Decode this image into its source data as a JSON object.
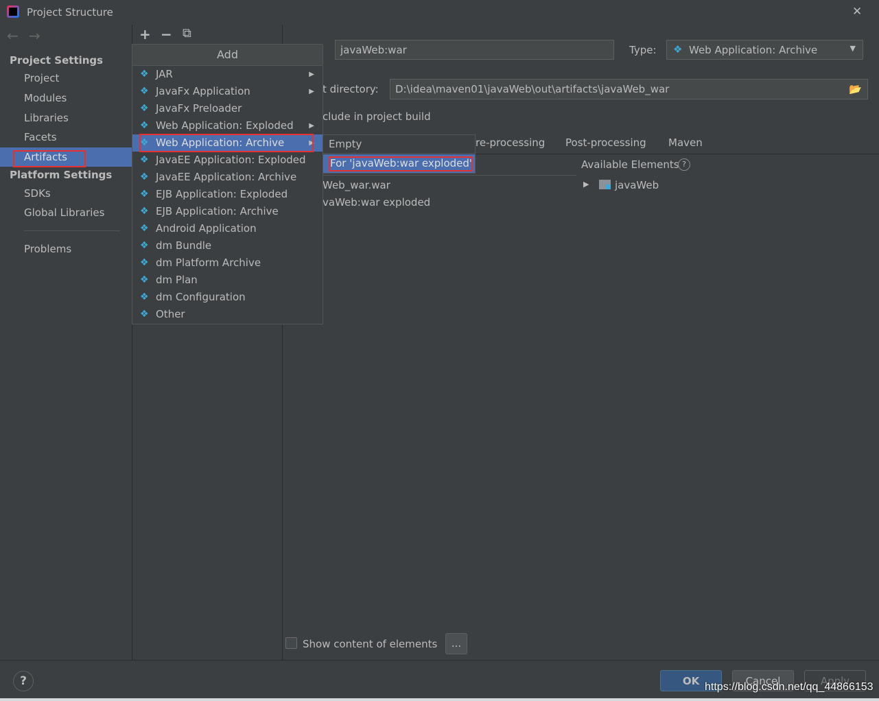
{
  "window": {
    "title": "Project Structure",
    "close": "✕"
  },
  "sidebar": {
    "project_settings": "Project Settings",
    "project_items": [
      "Project",
      "Modules",
      "Libraries",
      "Facets",
      "Artifacts"
    ],
    "platform_settings": "Platform Settings",
    "platform_items": [
      "SDKs",
      "Global Libraries"
    ],
    "problems": "Problems",
    "selected": "Artifacts"
  },
  "toolbar": {
    "add": "+",
    "remove": "−",
    "copy": "⧉"
  },
  "artifact": {
    "name": "javaWeb:war",
    "type_label": "Type:",
    "type_value": "Web Application: Archive",
    "output_dir_label": "t directory:",
    "output_dir": "D:\\idea\\maven01\\javaWeb\\out\\artifacts\\javaWeb_war",
    "include_label": "clude in project build",
    "tabs": [
      "re-processing",
      "Post-processing",
      "Maven"
    ],
    "available_elements": "Available Elements",
    "tree_items": [
      "Web_war.war",
      "vaWeb:war exploded"
    ],
    "available_tree": [
      "javaWeb"
    ],
    "show_content": "Show content of elements",
    "more": "..."
  },
  "add_menu": {
    "title": "Add",
    "items": [
      {
        "label": "JAR",
        "submenu": true
      },
      {
        "label": "JavaFx Application",
        "submenu": true
      },
      {
        "label": "JavaFx Preloader",
        "submenu": false
      },
      {
        "label": "Web Application: Exploded",
        "submenu": true
      },
      {
        "label": "Web Application: Archive",
        "submenu": true,
        "selected": true
      },
      {
        "label": "JavaEE Application: Exploded",
        "submenu": false
      },
      {
        "label": "JavaEE Application: Archive",
        "submenu": false
      },
      {
        "label": "EJB Application: Exploded",
        "submenu": false
      },
      {
        "label": "EJB Application: Archive",
        "submenu": false
      },
      {
        "label": "Android Application",
        "submenu": false
      },
      {
        "label": "dm Bundle",
        "submenu": false
      },
      {
        "label": "dm Platform Archive",
        "submenu": false
      },
      {
        "label": "dm Plan",
        "submenu": false
      },
      {
        "label": "dm Configuration",
        "submenu": false
      },
      {
        "label": "Other",
        "submenu": false
      }
    ]
  },
  "submenu": {
    "items": [
      "Empty",
      "For 'javaWeb:war exploded'"
    ],
    "selected": "For 'javaWeb:war exploded'"
  },
  "footer": {
    "help": "?",
    "ok": "OK",
    "cancel": "Cancel",
    "apply": "Apply",
    "watermark": "https://blog.csdn.net/qq_44866153"
  },
  "colors": {
    "selection": "#4b6eaf",
    "highlight_box": "#e8302f",
    "background": "#3c3f41"
  }
}
